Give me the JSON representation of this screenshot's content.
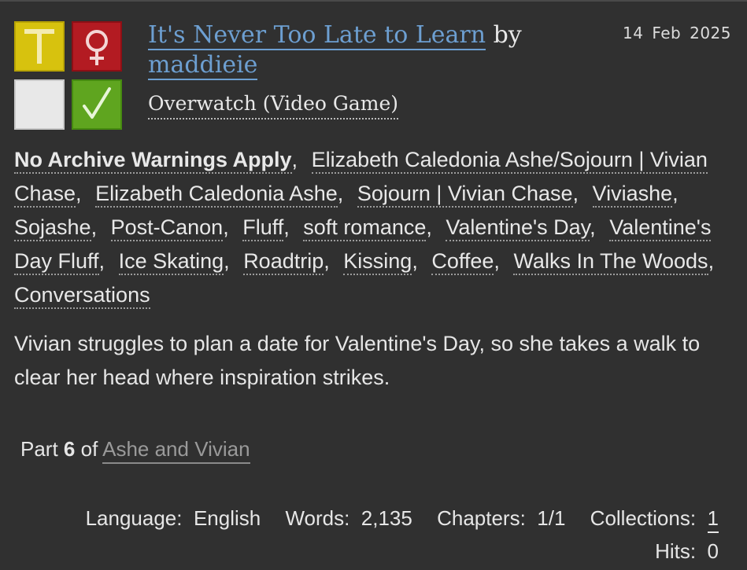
{
  "work": {
    "title": "It's Never Too Late to Learn",
    "by": "by",
    "author": "maddieie",
    "date": "14 Feb 2025",
    "fandom": "Overwatch (Video Game)",
    "required_tags": {
      "rating_letter": "T",
      "category_symbol": "♀",
      "complete_symbol": "✓",
      "colors": {
        "rating": "#d7c20e",
        "category": "#b31b22",
        "warning": "#e8e8e8",
        "complete": "#5fa51f"
      }
    },
    "tags": [
      "No Archive Warnings Apply",
      "Elizabeth Caledonia Ashe/Sojourn | Vivian Chase",
      "Elizabeth Caledonia Ashe",
      "Sojourn | Vivian Chase",
      "Viviashe",
      "Sojashe",
      "Post-Canon",
      "Fluff",
      "soft romance",
      "Valentine's Day",
      "Valentine's Day Fluff",
      "Ice Skating",
      "Roadtrip",
      "Kissing",
      "Coffee",
      "Walks In The Woods",
      "Conversations"
    ],
    "summary": "Vivian struggles to plan a date for Valentine's Day, so she takes a walk to clear her head where inspiration strikes.",
    "series": {
      "part_label": "Part",
      "part_number": "6",
      "of_label": "of",
      "name": "Ashe and Vivian"
    },
    "stats": {
      "language_label": "Language:",
      "language": "English",
      "words_label": "Words:",
      "words": "2,135",
      "chapters_label": "Chapters:",
      "chapters": "1/1",
      "collections_label": "Collections:",
      "collections": "1",
      "hits_label": "Hits:",
      "hits": "0"
    },
    "link_color": "#6d9fd1"
  }
}
